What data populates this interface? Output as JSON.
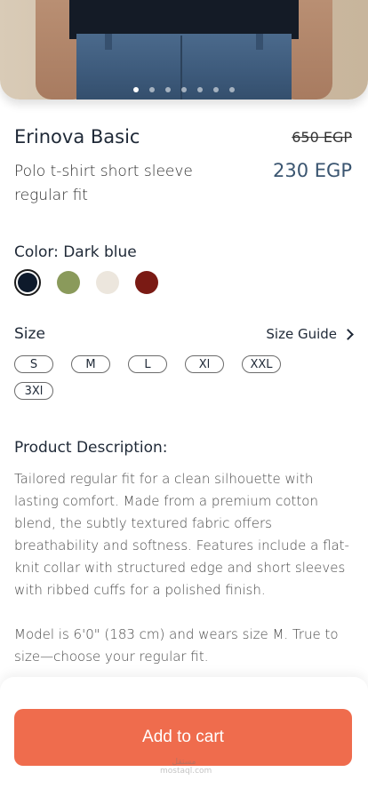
{
  "hero": {
    "image_alt": "product-image",
    "slide_count": 7,
    "active_slide": 1
  },
  "product": {
    "name": "Erinova Basic",
    "subtitle": "Polo t-shirt short sleeve regular fit",
    "old_price": "650 EGP",
    "new_price": "230 EGP"
  },
  "color": {
    "label": "Color: Dark blue",
    "options": [
      {
        "name": "Dark blue",
        "hex": "#0e1a2b",
        "selected": true
      },
      {
        "name": "Olive",
        "hex": "#8a9a5b",
        "selected": false
      },
      {
        "name": "Cream",
        "hex": "#ece6dd",
        "selected": false
      },
      {
        "name": "Maroon",
        "hex": "#7a1a14",
        "selected": false
      }
    ]
  },
  "size": {
    "label": "Size",
    "guide_label": "Size Guide",
    "options": [
      "S",
      "M",
      "L",
      "Xl",
      "XXL",
      "3Xl"
    ]
  },
  "description": {
    "title": "Product Description:",
    "body": "Tailored regular fit for a clean silhouette with lasting comfort. Made from a premium cotton blend, the subtly textured fabric offers breathability and softness. Features include a flat-knit collar with structured edge and short sleeves with ribbed cuffs for a polished finish.",
    "model_note": "Model is 6'0\" (183 cm) and wears size M. True to size—choose your regular fit."
  },
  "actions": {
    "add_to_cart": "Add to cart"
  },
  "watermark": {
    "line1": "مستقل",
    "line2": "mostaql.com"
  },
  "colors": {
    "accent": "#ef6c4d",
    "price": "#3a5570"
  }
}
